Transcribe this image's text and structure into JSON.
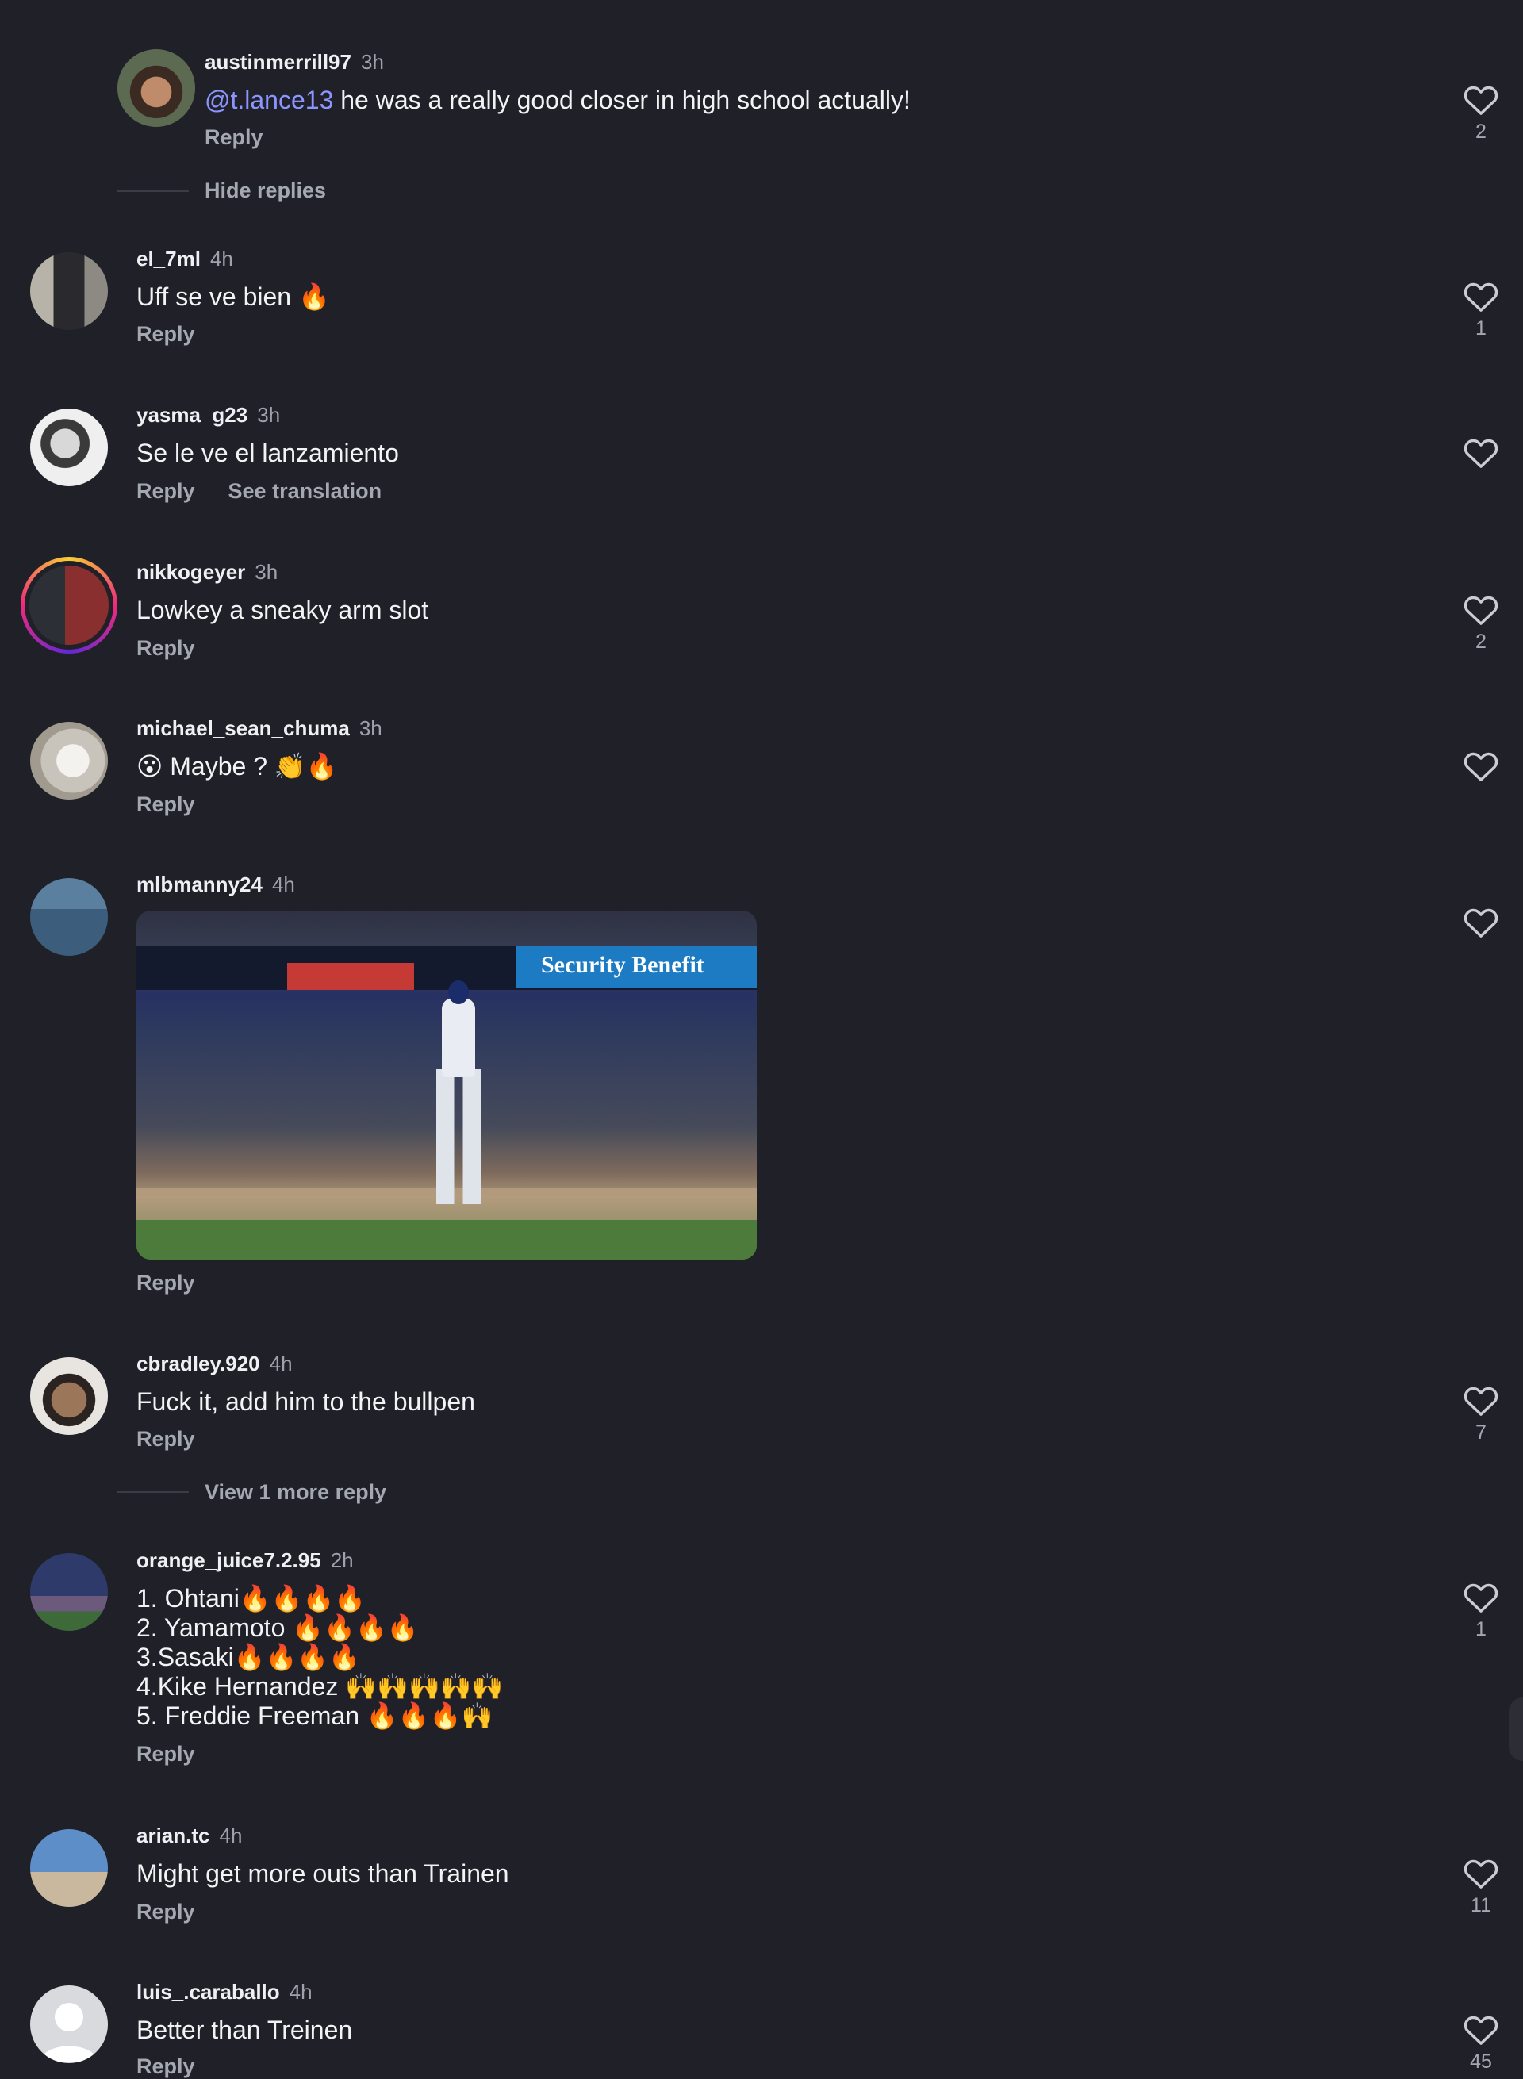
{
  "comments": [
    {
      "username": "austinmerrill97",
      "time": "3h",
      "mention": "@t.lance13",
      "text": " he was a really good closer in high school actually!",
      "reply": "Reply",
      "likes": "2"
    },
    {
      "thread_link": "Hide replies"
    },
    {
      "username": "el_7ml",
      "time": "4h",
      "text": "Uff se ve bien 🔥",
      "reply": "Reply",
      "likes": "1"
    },
    {
      "username": "yasma_g23",
      "time": "3h",
      "text": "Se le ve el lanzamiento",
      "reply": "Reply",
      "translate": "See translation",
      "likes": ""
    },
    {
      "username": "nikkogeyer",
      "time": "3h",
      "text": "Lowkey a sneaky arm slot",
      "reply": "Reply",
      "likes": "2"
    },
    {
      "username": "michael_sean_chuma",
      "time": "3h",
      "text": "😮 Maybe ? 👏🔥",
      "reply": "Reply",
      "likes": ""
    },
    {
      "username": "mlbmanny24",
      "time": "4h",
      "media_board_text": "Security Benefit",
      "reply": "Reply",
      "likes": ""
    },
    {
      "username": "cbradley.920",
      "time": "4h",
      "text": "Fuck it, add him to the bullpen",
      "reply": "Reply",
      "likes": "7"
    },
    {
      "thread_link": "View 1 more reply"
    },
    {
      "username": "orange_juice7.2.95",
      "time": "2h",
      "lines": [
        "1. Ohtani🔥🔥🔥🔥",
        "2. Yamamoto 🔥🔥🔥🔥",
        "3.Sasaki🔥🔥🔥🔥",
        "4.Kike Hernandez 🙌🙌🙌🙌🙌",
        "5. Freddie Freeman 🔥🔥🔥🙌"
      ],
      "reply": "Reply",
      "likes": "1"
    },
    {
      "username": "arian.tc",
      "time": "4h",
      "text": "Might get more outs than Trainen",
      "reply": "Reply",
      "likes": "11"
    },
    {
      "username": "luis_.caraballo",
      "time": "4h",
      "text": "Better than Treinen",
      "reply": "Reply",
      "likes": "45"
    }
  ],
  "colors": {
    "background": "#202128",
    "mention": "#8c95ff",
    "muted": "#a4a8b0"
  },
  "icons": {
    "like": "heart-outline-icon"
  }
}
